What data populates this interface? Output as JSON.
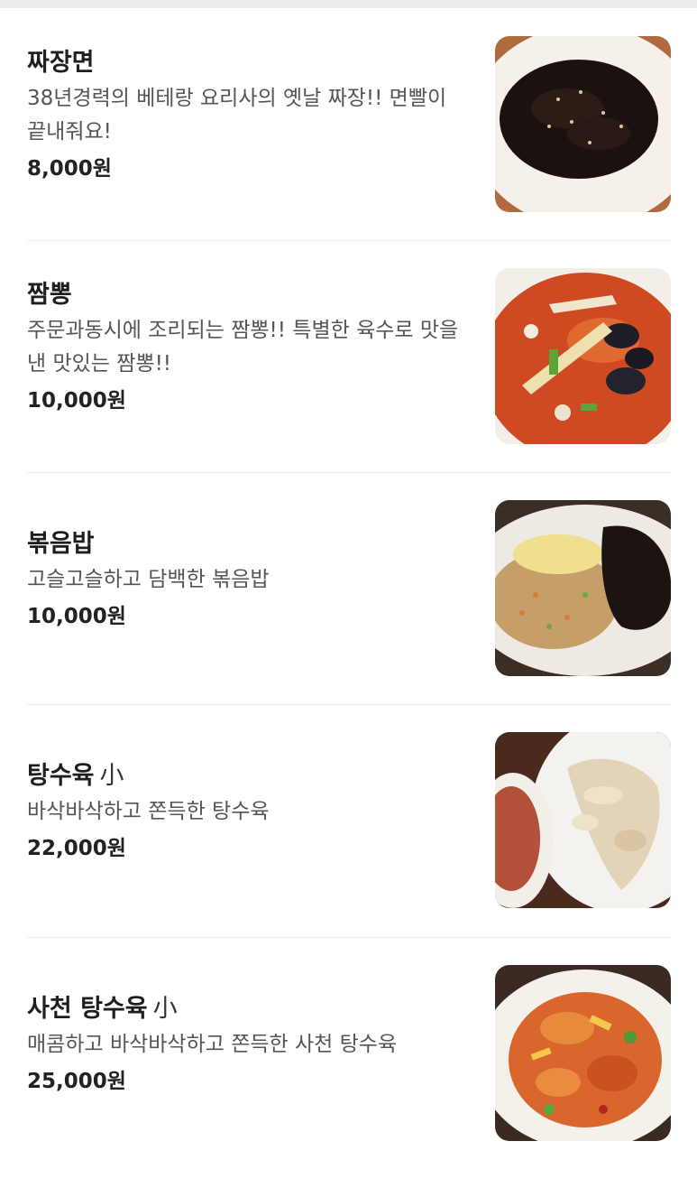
{
  "menu": [
    {
      "name": "짜장면",
      "size": "",
      "description": "38년경력의 베테랑 요리사의 옛날 짜장!! 면빨이 끝내줘요!",
      "price": "8,000원",
      "photo_icon": "jjajangmyeon-photo"
    },
    {
      "name": "짬뽕",
      "size": "",
      "description": "주문과동시에 조리되는 짬뽕!! 특별한 육수로 맛을낸 맛있는 짬뽕!!",
      "price": "10,000원",
      "photo_icon": "jjamppong-photo"
    },
    {
      "name": "볶음밥",
      "size": "",
      "description": "고슬고슬하고 담백한 볶음밥",
      "price": "10,000원",
      "photo_icon": "fried-rice-photo"
    },
    {
      "name": "탕수육",
      "size": "小",
      "description": "바삭바삭하고 쫀득한 탕수육",
      "price": "22,000원",
      "photo_icon": "tangsuyuk-photo"
    },
    {
      "name": "사천 탕수육",
      "size": "小",
      "description": "매콤하고 바삭바삭하고 쫀득한 사천 탕수육",
      "price": "25,000원",
      "photo_icon": "sichuan-tangsuyuk-photo"
    }
  ],
  "colors": {
    "title": "#1e1e1e",
    "description": "#555555",
    "divider": "#ebebeb"
  }
}
